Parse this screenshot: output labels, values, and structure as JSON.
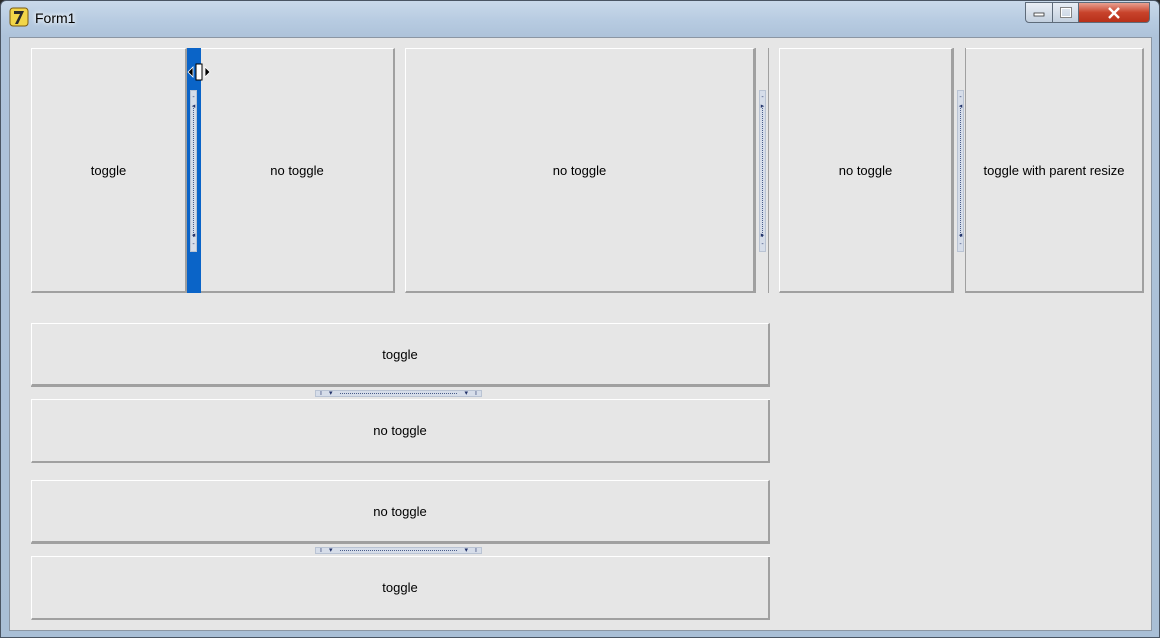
{
  "window": {
    "title": "Form1"
  },
  "panels": {
    "top_left_a": "toggle",
    "top_left_b": "no toggle",
    "top_mid": "no toggle",
    "top_right_a": "no toggle",
    "top_right_b": "toggle with parent resize",
    "mid_top": "toggle",
    "mid_bottom": "no toggle",
    "bottom_top": "no toggle",
    "bottom_bottom": "toggle"
  },
  "colors": {
    "active_splitter": "#0a64c8",
    "panel_bg": "#e6e6e6",
    "close_button": "#c8432b"
  },
  "icons": {
    "app": "app-logo-icon",
    "minimize": "minimize-icon",
    "maximize": "maximize-icon",
    "close": "close-icon",
    "cursor": "resize-cursor-icon"
  }
}
